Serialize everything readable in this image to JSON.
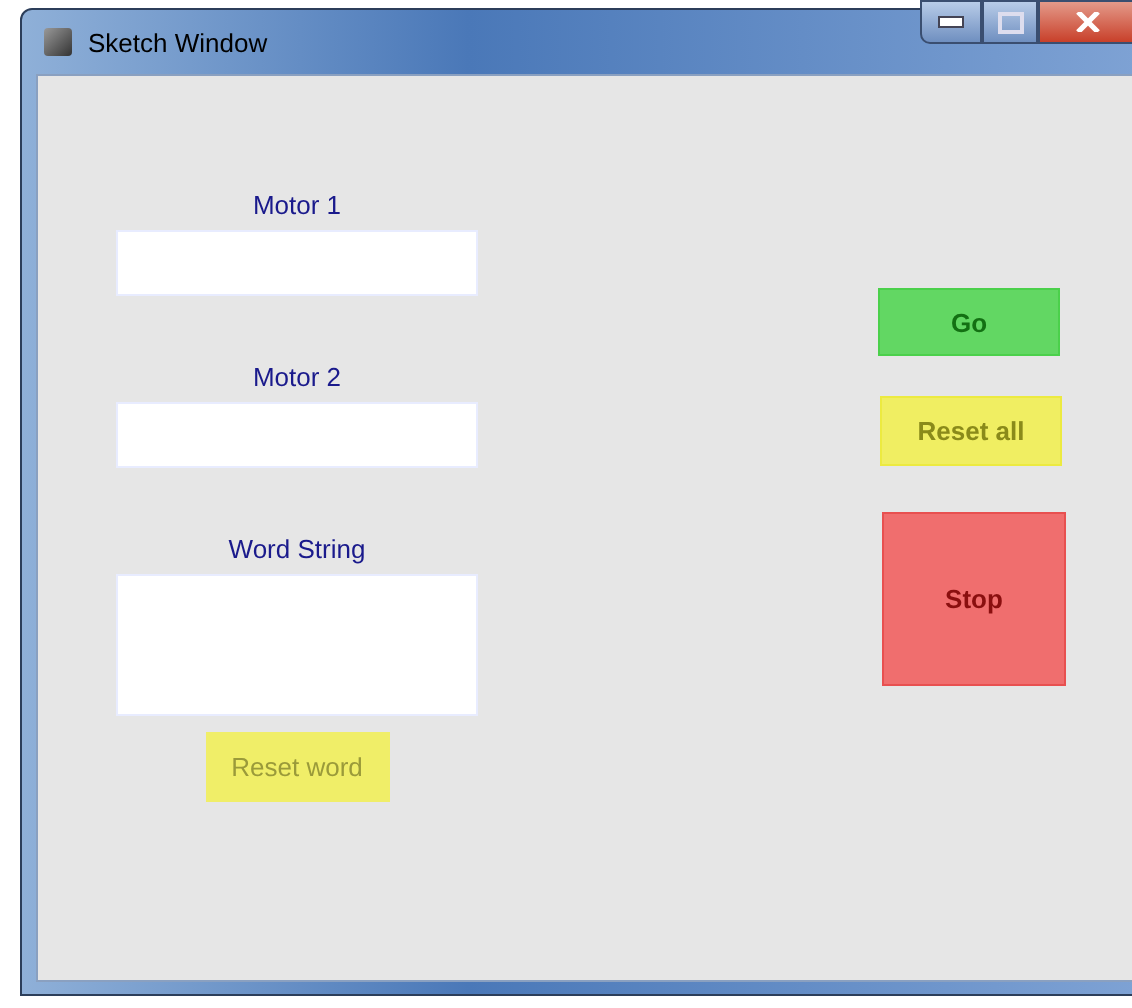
{
  "window": {
    "title": "Sketch Window"
  },
  "fields": [
    {
      "label": "Motor 1",
      "kind": "line"
    },
    {
      "label": "Motor 2",
      "kind": "line"
    },
    {
      "label": "Word String",
      "kind": "area"
    }
  ],
  "reset_word_button": {
    "label": "Reset word",
    "kind": "yellow-plain"
  },
  "buttons": [
    {
      "label": "Go",
      "kind": "go"
    },
    {
      "label": "Reset all",
      "kind": "reset"
    },
    {
      "label": "Stop",
      "kind": "stop"
    }
  ]
}
